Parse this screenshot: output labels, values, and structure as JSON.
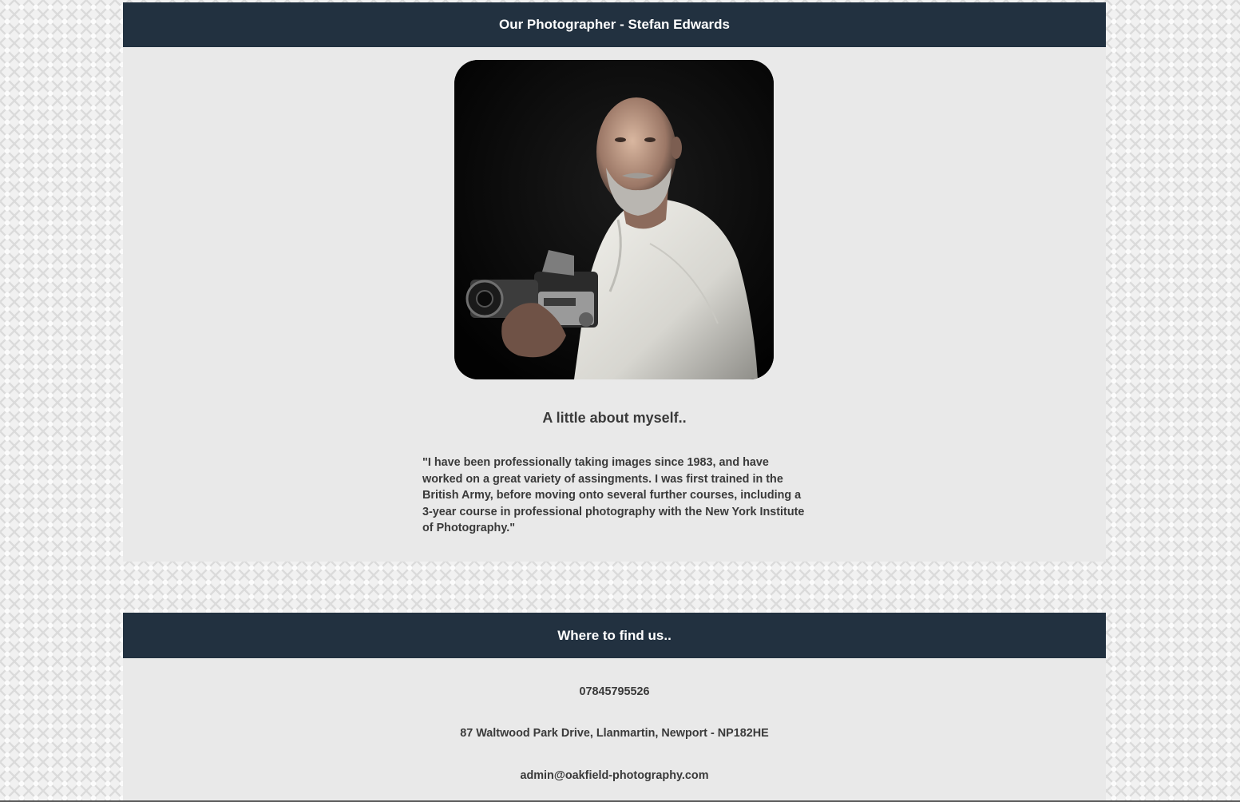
{
  "photographer_section": {
    "title": "Our Photographer - Stefan Edwards",
    "about_heading": "A little about myself..",
    "quote": "\"I have been professionally taking images since 1983, and have worked on a great variety of assingments. I was first trained in the British Army, before moving onto several further courses, including a 3-year course in professional photography with the New York Institute of Photography.\""
  },
  "find_section": {
    "title": "Where to find us..",
    "phone": "07845795526",
    "address": "87 Waltwood Park Drive, Llanmartin, Newport - NP182HE",
    "email": "admin@oakfield-photography.com"
  },
  "colors": {
    "header_bg": "#223140",
    "panel_bg": "#e9e9e9",
    "text": "#3a3a3a"
  }
}
